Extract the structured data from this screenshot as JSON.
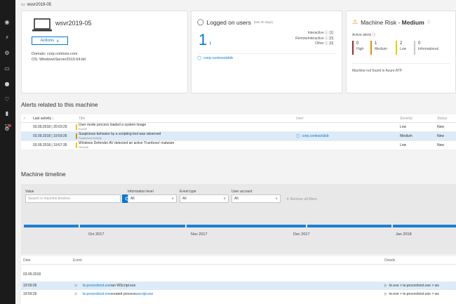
{
  "rail": {
    "icons": [
      "shield-icon",
      "lightning-icon",
      "gear-icon",
      "laptop-icon",
      "people-icon",
      "heart-icon",
      "server-icon",
      "flask-icon",
      "settings-alert-icon"
    ]
  },
  "breadcrumb": {
    "label": "wsvr2019-05"
  },
  "machine": {
    "name": "wsvr2019-05",
    "actions_label": "Actions",
    "domain": "Domain: corp.contoso.com",
    "os": "OS: WindowsServer2019 64-bit"
  },
  "users": {
    "title": "Logged on users",
    "subtitle": "(last 30 days)",
    "count": "1",
    "stats": [
      "Interactive ⓘ [1]",
      "RemoteInteractive ⓘ [0]",
      "Other ⓘ [0]"
    ],
    "user_link": "corp.contoso\\dsb"
  },
  "risk": {
    "title_prefix": "Machine Risk - ",
    "level": "Medium",
    "active_alerts_label": "Active alerts ⓘ",
    "severities": [
      {
        "count": "0",
        "label": "High",
        "color": "#a4262c"
      },
      {
        "count": "1",
        "label": "Medium",
        "color": "#e38b00"
      },
      {
        "count": "2",
        "label": "Low",
        "color": "#f2c811"
      },
      {
        "count": "0",
        "label": "Informational",
        "color": "#c8c8c8"
      }
    ],
    "atp_msg": "Machine not found in Azure ATP"
  },
  "alerts": {
    "heading": "Alerts related to this machine",
    "columns": {
      "last": "Last activity ↓",
      "title": "Title",
      "user": "User",
      "severity": "Severity",
      "status": "Status"
    },
    "rows": [
      {
        "date": "03.09.2018 | 20:03:29",
        "title": "User mode process loaded a system image",
        "sub": "Exploit",
        "user": "",
        "severity": "Low",
        "status": "New"
      },
      {
        "date": "03.09.2018 | 19:59:26",
        "title": "Suspicious behavior by a scripting tool was observed",
        "sub": "Suspicious Activity",
        "user": "corp.contoso\\dsb",
        "severity": "Medium",
        "status": "New"
      },
      {
        "date": "03.09.2018 | 19:57:35",
        "title": "Windows Defender AV detected an active 'Fuerboos' malware",
        "sub": "General",
        "user": "",
        "severity": "Low",
        "status": "New"
      }
    ]
  },
  "timeline": {
    "heading": "Machine timeline",
    "value_label": "Value",
    "search_placeholder": "Search in machine timeline",
    "info_label": "Information level",
    "info_value": "All",
    "event_label": "Event type",
    "event_value": "All",
    "user_label": "User account",
    "user_value": "All",
    "remove_label": "✕ Remove all filters",
    "ticks": [
      "Oct 2017",
      "Nov 2017",
      "Dec 2017",
      "Jan 2018"
    ]
  },
  "events": {
    "columns": {
      "date": "Date",
      "event": "Event",
      "details": "Details"
    },
    "group_date": "03.09.2018",
    "rows": [
      {
        "time": "19:59:26",
        "actor": "te.proceshoot.exe",
        "action": " ran WScript.exe",
        "target": "",
        "details": "te.exe > te.proceshoot.exe > ws"
      },
      {
        "time": "19:59:26",
        "actor": "te.proceshoot.exe",
        "action": " created process ",
        "target": "wscript.exe",
        "details": "te.exe > te.proceshoot.exe > ws"
      }
    ]
  }
}
